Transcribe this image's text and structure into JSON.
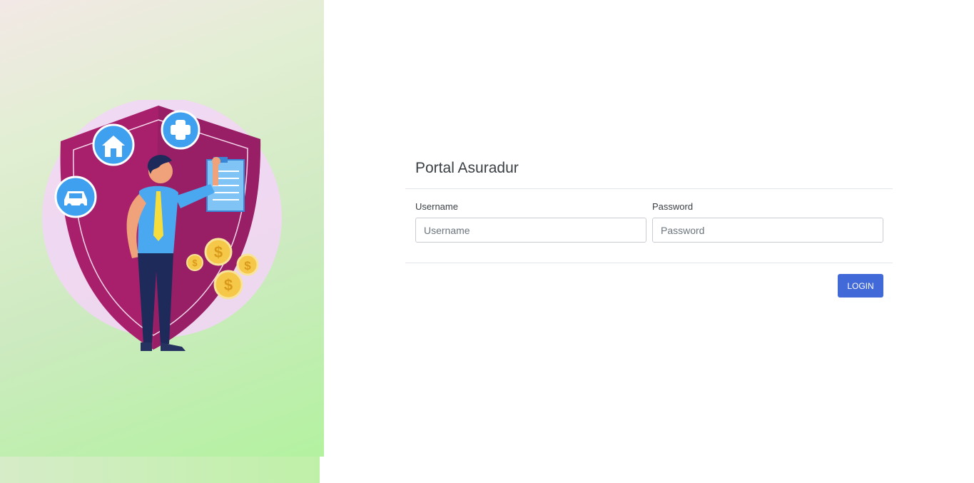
{
  "login": {
    "title": "Portal Asuradur",
    "username": {
      "label": "Username",
      "placeholder": "Username",
      "value": ""
    },
    "password": {
      "label": "Password",
      "placeholder": "Password",
      "value": ""
    },
    "submit_label": "LOGIN"
  },
  "illustration": {
    "subject": "insurance-agent-with-shield",
    "icons": [
      "home-icon",
      "medical-cross-icon",
      "car-icon",
      "clipboard-icon",
      "dollar-coin-icon"
    ],
    "colors": {
      "shield": "#b01a6a",
      "circle": "#f2d6f5",
      "badge": "#3fa0f0",
      "coin": "#f5c84a",
      "shirt": "#4aa8f0",
      "pants": "#1e2a5a"
    }
  },
  "colors": {
    "button": "#4169d8",
    "panel_gradient_start": "#f3e8e6",
    "panel_gradient_end": "#b3f2a0"
  }
}
